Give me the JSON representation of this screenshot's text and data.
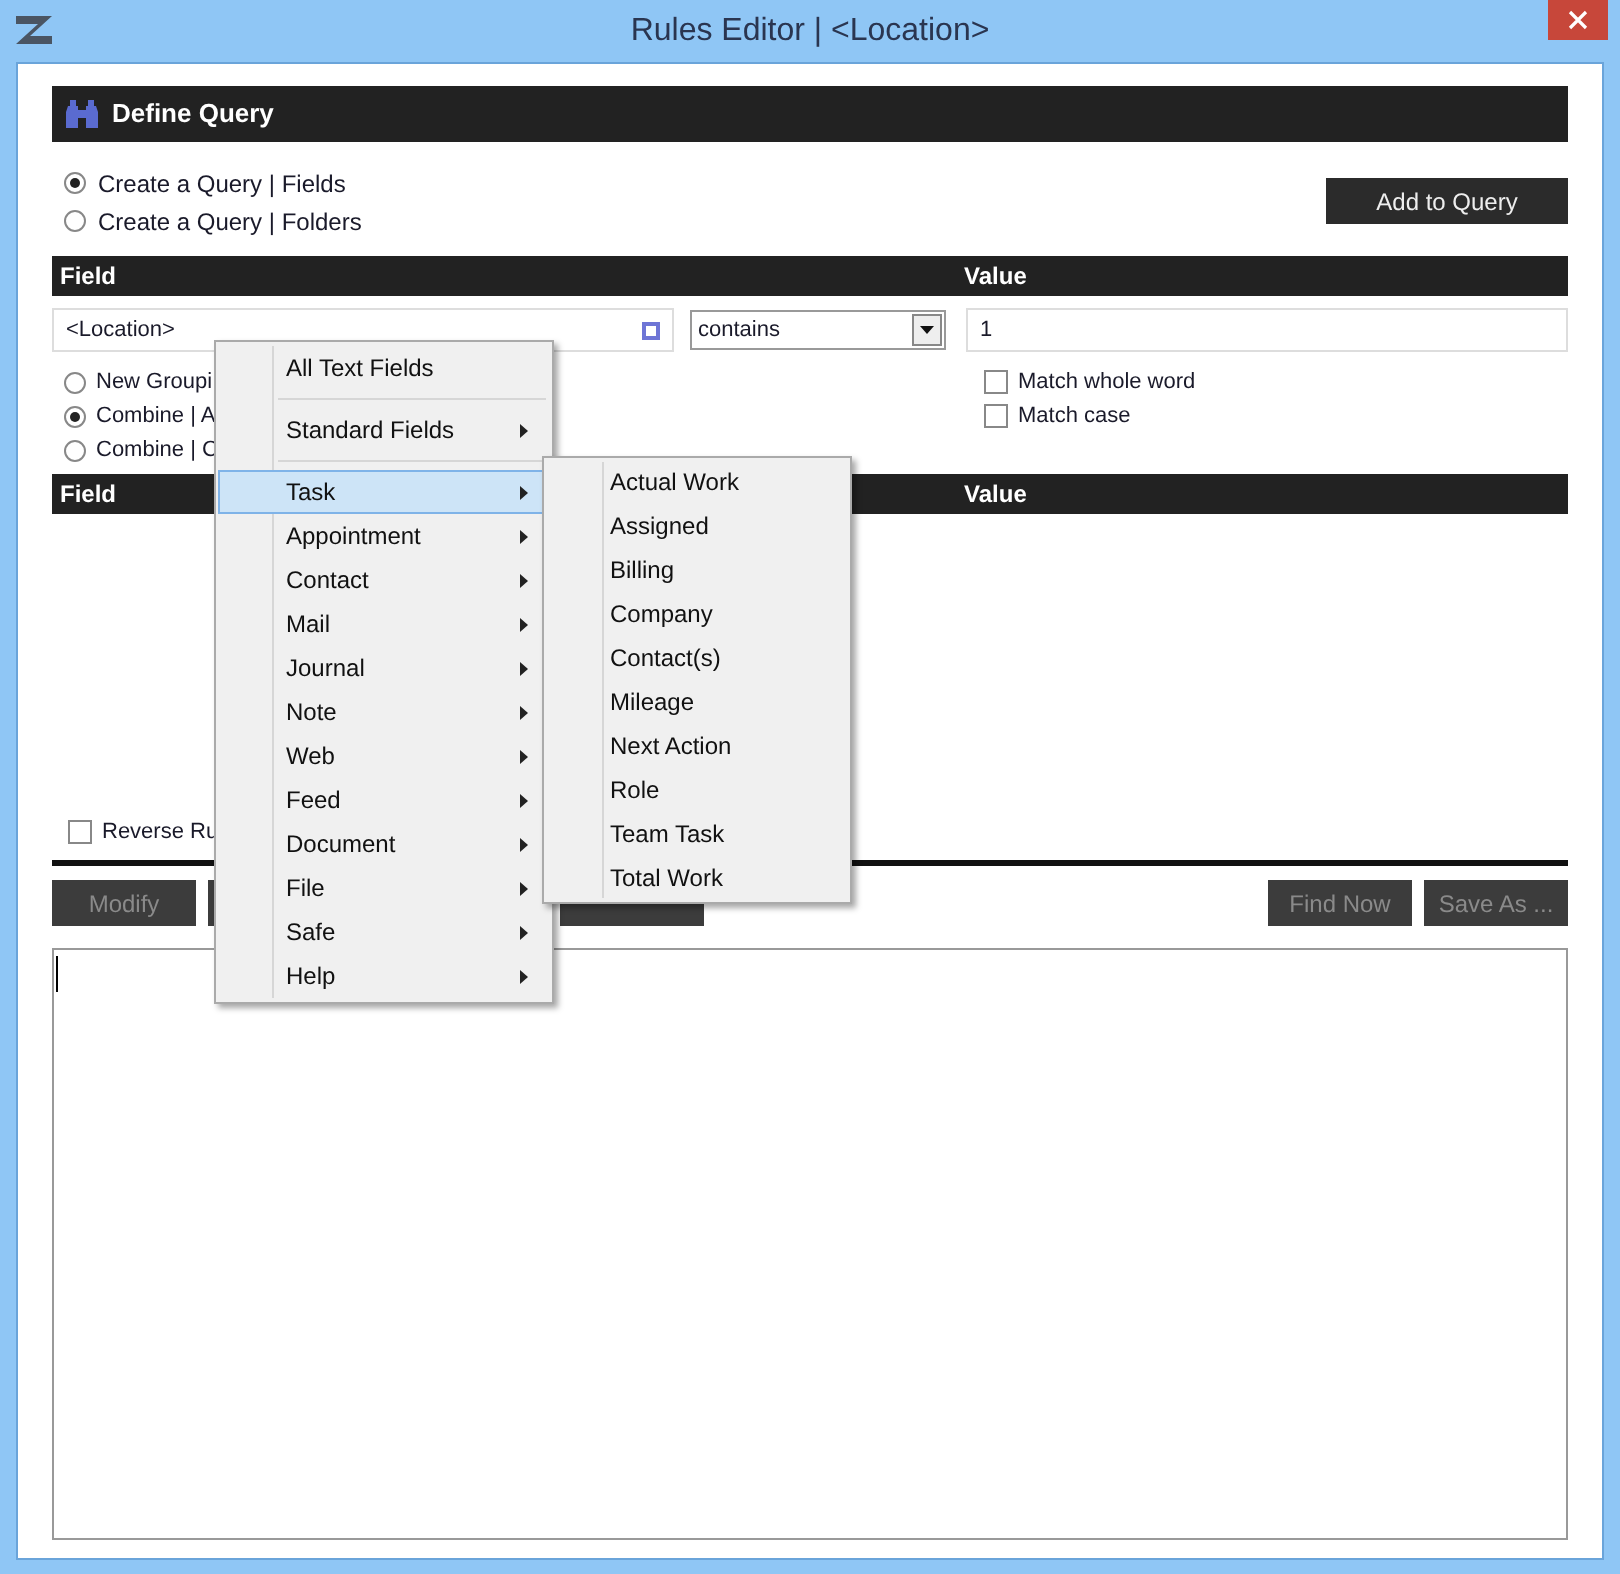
{
  "window": {
    "title": "Rules Editor  |  <Location>"
  },
  "header": {
    "title": "Define Query"
  },
  "query_modes": [
    {
      "label": "Create a Query | Fields",
      "selected": true
    },
    {
      "label": "Create a Query | Folders",
      "selected": false
    }
  ],
  "add_button": "Add to Query",
  "columns": [
    "Field",
    "Value"
  ],
  "field_input": {
    "value": "<Location>"
  },
  "operator": {
    "value": "contains"
  },
  "value_input": {
    "value": "1"
  },
  "grouping": [
    {
      "label": "New Groupi",
      "selected": false
    },
    {
      "label": "Combine | A",
      "selected": true
    },
    {
      "label": "Combine | C",
      "selected": false
    }
  ],
  "options": [
    {
      "label": "Match whole word",
      "checked": false
    },
    {
      "label": "Match case",
      "checked": false
    }
  ],
  "list_columns": [
    "Field",
    "Value"
  ],
  "reverse": {
    "label": "Reverse Ru",
    "checked": false
  },
  "buttons_left": [
    {
      "label": "Modify"
    }
  ],
  "buttons_right": [
    {
      "label": "Find Now"
    },
    {
      "label": "Save As ..."
    }
  ],
  "menu": [
    {
      "kind": "item",
      "label": "All Text Fields",
      "submenu": false,
      "selected": false
    },
    {
      "kind": "separator"
    },
    {
      "kind": "item",
      "label": "Standard Fields",
      "submenu": true,
      "selected": false
    },
    {
      "kind": "separator"
    },
    {
      "kind": "item",
      "label": "Task",
      "submenu": true,
      "selected": true
    },
    {
      "kind": "item",
      "label": "Appointment",
      "submenu": true,
      "selected": false
    },
    {
      "kind": "item",
      "label": "Contact",
      "submenu": true,
      "selected": false
    },
    {
      "kind": "item",
      "label": "Mail",
      "submenu": true,
      "selected": false
    },
    {
      "kind": "item",
      "label": "Journal",
      "submenu": true,
      "selected": false
    },
    {
      "kind": "item",
      "label": "Note",
      "submenu": true,
      "selected": false
    },
    {
      "kind": "item",
      "label": "Web",
      "submenu": true,
      "selected": false
    },
    {
      "kind": "item",
      "label": "Feed",
      "submenu": true,
      "selected": false
    },
    {
      "kind": "item",
      "label": "Document",
      "submenu": true,
      "selected": false
    },
    {
      "kind": "item",
      "label": "File",
      "submenu": true,
      "selected": false
    },
    {
      "kind": "item",
      "label": "Safe",
      "submenu": true,
      "selected": false
    },
    {
      "kind": "item",
      "label": "Help",
      "submenu": true,
      "selected": false
    }
  ],
  "submenu": [
    "Actual Work",
    "Assigned",
    "Billing",
    "Company",
    "Contact(s)",
    "Mileage",
    "Next Action",
    "Role",
    "Team Task",
    "Total Work"
  ]
}
